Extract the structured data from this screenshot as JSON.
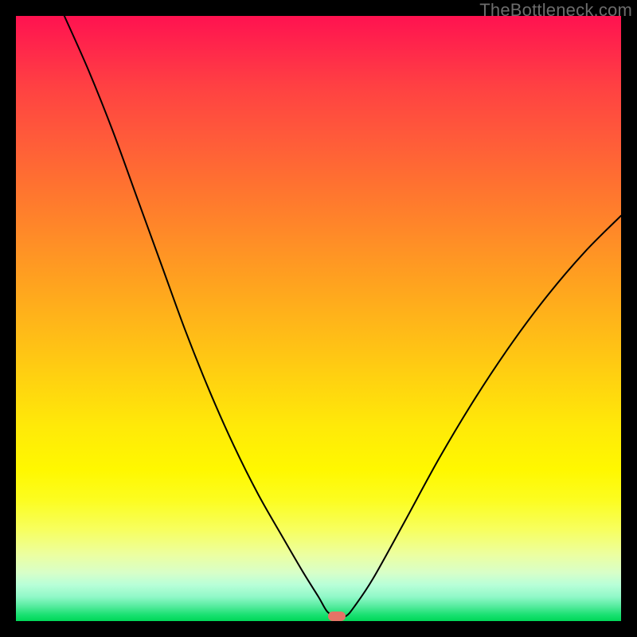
{
  "attribution": "TheBottleneck.com",
  "marker": {
    "x_frac": 0.53,
    "y_frac": 0.992,
    "color": "#e57366"
  },
  "chart_data": {
    "type": "line",
    "title": "",
    "xlabel": "",
    "ylabel": "",
    "xlim": [
      0,
      1
    ],
    "ylim": [
      0,
      1
    ],
    "x": [
      0.08,
      0.12,
      0.16,
      0.2,
      0.24,
      0.28,
      0.32,
      0.36,
      0.4,
      0.44,
      0.475,
      0.5,
      0.515,
      0.53,
      0.545,
      0.56,
      0.59,
      0.64,
      0.7,
      0.76,
      0.82,
      0.88,
      0.94,
      1.0
    ],
    "y": [
      1.0,
      0.91,
      0.81,
      0.7,
      0.59,
      0.48,
      0.38,
      0.29,
      0.21,
      0.14,
      0.08,
      0.04,
      0.015,
      0.008,
      0.008,
      0.025,
      0.07,
      0.16,
      0.27,
      0.37,
      0.46,
      0.54,
      0.61,
      0.67
    ],
    "series": [
      {
        "name": "bottleneck-curve",
        "stroke": "#000000",
        "stroke_width": 2
      }
    ],
    "gradient_stops": [
      {
        "pos": 0.0,
        "color": "#ff1250"
      },
      {
        "pos": 0.5,
        "color": "#ffc015"
      },
      {
        "pos": 0.78,
        "color": "#fff800"
      },
      {
        "pos": 1.0,
        "color": "#00d858"
      }
    ],
    "marker_point": {
      "x": 0.53,
      "y": 0.008
    }
  }
}
